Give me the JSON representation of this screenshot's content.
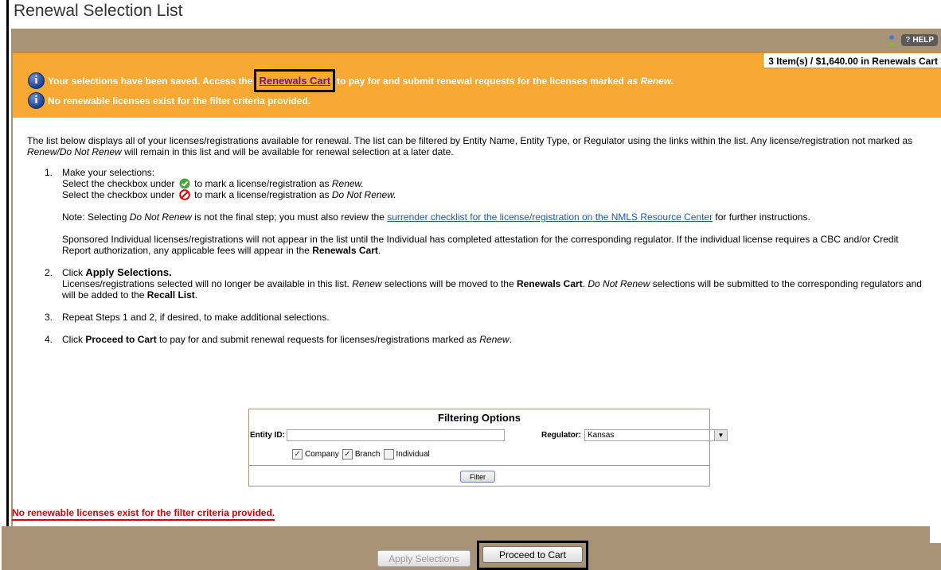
{
  "page": {
    "title": "Renewal Selection List"
  },
  "toolbar": {
    "help_label": "HELP",
    "help_prefix": "?"
  },
  "cart": {
    "summary": "3 Item(s) / $1,640.00 in Renewals Cart"
  },
  "messages": {
    "saved_prefix": "Your selections have been saved. Access the",
    "renewals_cart_link": "Renewals Cart",
    "saved_suffix": "to pay for and submit renewal requests for the licenses marked",
    "saved_emph": "as Renew.",
    "no_licenses": "No renewable licenses exist for the filter criteria provided."
  },
  "intro": {
    "p1": "The list below displays all of your licenses/registrations available for renewal. The list can be filtered by Entity Name, Entity Type, or Regulator using the links within the list. Any license/registration not marked as ",
    "p1_em": "Renew/Do Not Renew",
    "p1_end": " will remain in this list and will be available for renewal selection at a later date."
  },
  "steps": {
    "s1_num": "1.",
    "s1_title": "Make your selections:",
    "s1_line1_a": "Select the checkbox under",
    "s1_line1_b": "to mark a license/registration as",
    "s1_line1_em": "Renew.",
    "s1_line2_a": "Select the checkbox under",
    "s1_line2_b": "to mark a license/registration as",
    "s1_line2_em": "Do Not Renew.",
    "note_a": "Note: Selecting ",
    "note_em": "Do Not Renew",
    "note_b": " is not the final step; you must also review the ",
    "note_link": "surrender checklist for the license/registration on the NMLS Resource Center",
    "note_c": " for further instructions.",
    "sponsored_a": "Sponsored Individual licenses/registrations will not appear in the list until the Individual has completed attestation for the corresponding regulator. If the individual license requires a CBC and/or Credit Report authorization, any applicable fees will appear in the ",
    "sponsored_bold": "Renewals Cart",
    "sponsored_end": ".",
    "s2_num": "2.",
    "s2_pre": "Click ",
    "s2_title": "Apply Selections.",
    "s2_a": "Licenses/registrations selected will no longer be available in this list. ",
    "s2_em1": "Renew",
    "s2_b": " selections will be moved to the ",
    "s2_bold1": "Renewals Cart",
    "s2_c": ". ",
    "s2_em2": "Do Not Renew",
    "s2_d": " selections will be submitted to the corresponding regulators and will be added to the ",
    "s2_bold2": "Recall List",
    "s2_e": ".",
    "s3_num": "3.",
    "s3_text": "Repeat Steps 1 and 2, if desired, to make additional selections.",
    "s4_num": "4.",
    "s4_pre": "Click ",
    "s4_bold": "Proceed to Cart",
    "s4_mid": " to pay for and submit renewal requests for licenses/registrations marked as ",
    "s4_em": "Renew",
    "s4_end": "."
  },
  "filter": {
    "title": "Filtering Options",
    "entity_label": "Entity ID:",
    "entity_value": "",
    "regulator_label": "Regulator:",
    "regulator_value": "Kansas",
    "company_label": "Company",
    "company_checked": true,
    "branch_label": "Branch",
    "branch_checked": true,
    "individual_label": "Individual",
    "individual_checked": false,
    "filter_button": "Filter"
  },
  "error": {
    "text": "No renewable licenses exist for the filter criteria provided."
  },
  "buttons": {
    "apply": "Apply Selections",
    "proceed": "Proceed to Cart"
  }
}
